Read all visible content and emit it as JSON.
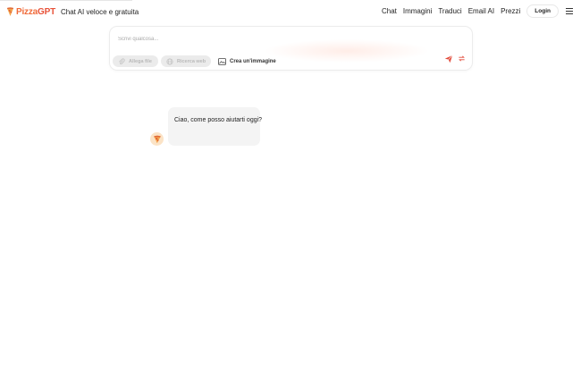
{
  "header": {
    "brand_pizza": "Pizza",
    "brand_gpt": "GPT",
    "tagline": "Chat AI veloce e gratuita",
    "nav": [
      {
        "label": "Chat"
      },
      {
        "label": "Immagini"
      },
      {
        "label": "Traduci"
      },
      {
        "label": "Email AI"
      },
      {
        "label": "Prezzi"
      }
    ],
    "login_label": "Login",
    "menu_icon": "hamburger-menu-icon"
  },
  "composer": {
    "placeholder": "Scrivi qualcosa...",
    "value": "",
    "attach_label": "Allega file",
    "web_label": "Ricerca web",
    "create_image_label": "Crea un'immagine",
    "send_icon": "send-icon",
    "swap_icon": "swap-arrows-icon"
  },
  "chat": {
    "assistant_message": "Ciao, come posso aiutarti oggi?",
    "avatar_icon": "pizza-icon"
  },
  "colors": {
    "brand_orange": "#f06b3a",
    "brand_red": "#e8533a",
    "chip_bg": "#ebebeb",
    "bubble_bg": "#f4f4f4",
    "avatar_bg": "#fbe3c6"
  }
}
